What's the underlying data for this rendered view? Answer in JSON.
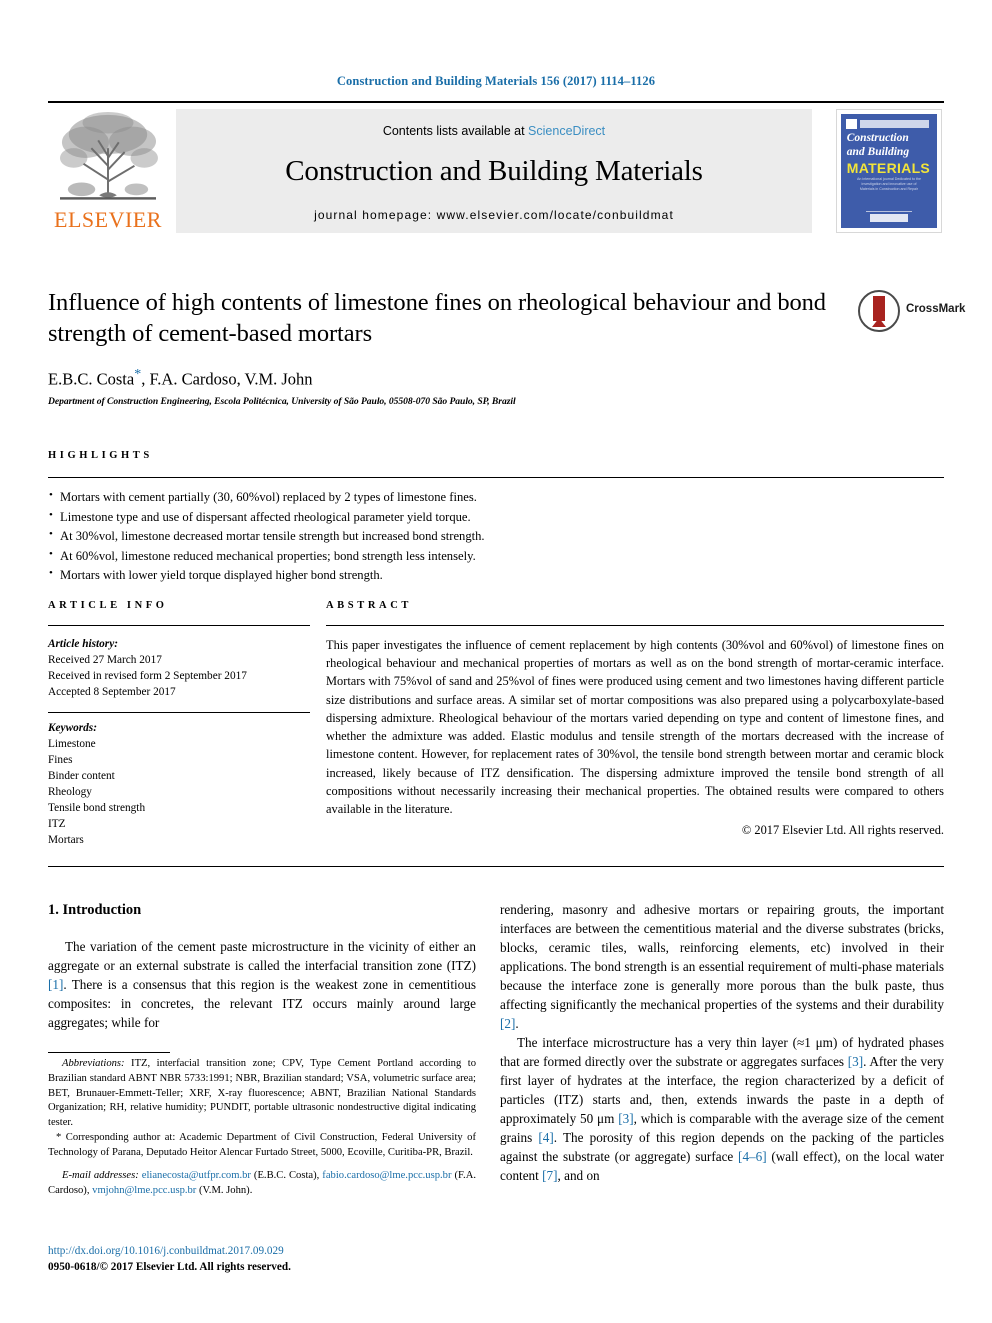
{
  "running_head": "Construction and Building Materials 156 (2017) 1114–1126",
  "masthead": {
    "contents_prefix": "Contents lists available at ",
    "sciencedirect": "ScienceDirect",
    "journal_title": "Construction and Building Materials",
    "homepage": "journal homepage: www.elsevier.com/locate/conbuildmat",
    "publisher": "ELSEVIER",
    "cover": {
      "line1": "Construction",
      "line2": "and Building",
      "line3": "MATERIALS",
      "blurb": "An international journal Dedicated to the investigation and innovative use of Materials in Construction and Repair"
    }
  },
  "title": "Influence of high contents of limestone fines on rheological behaviour and bond strength of cement-based mortars",
  "authors": "E.B.C. Costa",
  "authors_rest": ", F.A. Cardoso, V.M. John",
  "affiliation": "Department of Construction Engineering, Escola Politécnica, University of São Paulo, 05508-070 São Paulo, SP, Brazil",
  "crossmark_label": "CrossMark",
  "highlights": {
    "heading": "HIGHLIGHTS",
    "items": [
      "Mortars with cement partially (30, 60%vol) replaced by 2 types of limestone fines.",
      "Limestone type and use of dispersant affected rheological parameter yield torque.",
      "At 30%vol, limestone decreased mortar tensile strength but increased bond strength.",
      "At 60%vol, limestone reduced mechanical properties; bond strength less intensely.",
      "Mortars with lower yield torque displayed higher bond strength."
    ]
  },
  "article_info": {
    "heading": "ARTICLE INFO",
    "history_label": "Article history:",
    "history": [
      "Received 27 March 2017",
      "Received in revised form 2 September 2017",
      "Accepted 8 September 2017"
    ],
    "keywords_label": "Keywords:",
    "keywords": [
      "Limestone",
      "Fines",
      "Binder content",
      "Rheology",
      "Tensile bond strength",
      "ITZ",
      "Mortars"
    ]
  },
  "abstract": {
    "heading": "ABSTRACT",
    "text": "This paper investigates the influence of cement replacement by high contents (30%vol and 60%vol) of limestone fines on rheological behaviour and mechanical properties of mortars as well as on the bond strength of mortar-ceramic interface. Mortars with 75%vol of sand and 25%vol of fines were produced using cement and two limestones having different particle size distributions and surface areas. A similar set of mortar compositions was also prepared using a polycarboxylate-based dispersing admixture. Rheological behaviour of the mortars varied depending on type and content of limestone fines, and whether the admixture was added. Elastic modulus and tensile strength of the mortars decreased with the increase of limestone content. However, for replacement rates of 30%vol, the tensile bond strength between mortar and ceramic block increased, likely because of ITZ densification. The dispersing admixture improved the tensile bond strength of all compositions without necessarily increasing their mechanical properties. The obtained results were compared to others available in the literature.",
    "copyright": "© 2017 Elsevier Ltd. All rights reserved."
  },
  "body": {
    "section_number_title": "1. Introduction",
    "left_p1_a": "The variation of the cement paste microstructure in the vicinity of either an aggregate or an external substrate is called the interfacial transition zone (ITZ) ",
    "left_p1_ref": "[1]",
    "left_p1_b": ". There is a consensus that this region is the weakest zone in cementitious composites: in concretes, the relevant ITZ occurs mainly around large aggregates; while for",
    "right_p1_a": "rendering, masonry and adhesive mortars or repairing grouts, the important interfaces are between the cementitious material and the diverse substrates (bricks, blocks, ceramic tiles, walls, reinforcing elements, etc) involved in their applications. The bond strength is an essential requirement of multi-phase materials because the interface zone is generally more porous than the bulk paste, thus affecting significantly the mechanical properties of the systems and their durability ",
    "right_p1_ref": "[2]",
    "right_p1_b": ".",
    "right_p2_a": "The interface microstructure has a very thin layer (≈1 μm) of hydrated phases that are formed directly over the substrate or aggregates surfaces ",
    "right_p2_ref1": "[3]",
    "right_p2_b": ". After the very first layer of hydrates at the interface, the region characterized by a deficit of particles (ITZ) starts and, then, extends inwards the paste in a depth of approximately 50 μm ",
    "right_p2_ref2": "[3]",
    "right_p2_c": ", which is comparable with the average size of the cement grains ",
    "right_p2_ref3": "[4]",
    "right_p2_d": ". The porosity of this region depends on the packing of the particles against the substrate (or aggregate) surface ",
    "right_p2_ref4": "[4–6]",
    "right_p2_e": " (wall effect), on the local water content ",
    "right_p2_ref5": "[7]",
    "right_p2_f": ", and on"
  },
  "footnotes": {
    "abbrev_label": "Abbreviations:",
    "abbrev_text": " ITZ, interfacial transition zone; CPV, Type Cement Portland according to Brazilian standard ABNT NBR 5733:1991; NBR, Brazilian standard; VSA, volumetric surface area; BET, Brunauer-Emmett-Teller; XRF, X-ray fluorescence; ABNT, Brazilian National Standards Organization; RH, relative humidity; PUNDIT, portable ultrasonic nondestructive digital indicating tester.",
    "corresponding": "* Corresponding author at: Academic Department of Civil Construction, Federal University of Technology of Parana, Deputado Heitor Alencar Furtado Street, 5000, Ecoville, Curitiba-PR, Brazil.",
    "email_label": "E-mail addresses:",
    "email1": "elianecosta@utfpr.com.br",
    "email1_who": " (E.B.C. Costa), ",
    "email2": "fabio.cardoso@lme.pcc.usp.br",
    "email2_who": " (F.A. Cardoso), ",
    "email3": "vmjohn@lme.pcc.usp.br",
    "email3_who": " (V.M. John)."
  },
  "doi": "http://dx.doi.org/10.1016/j.conbuildmat.2017.09.029",
  "issn_line": "0950-0618/© 2017 Elsevier Ltd. All rights reserved."
}
